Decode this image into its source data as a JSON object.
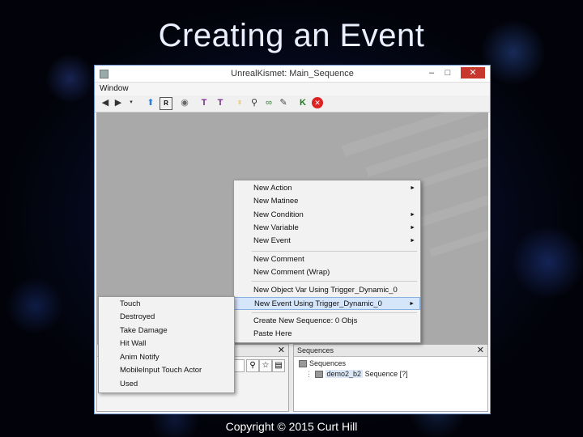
{
  "slide": {
    "title": "Creating an Event",
    "copyright": "Copyright © 2015 Curt Hill"
  },
  "window": {
    "title": "UnrealKismet: Main_Sequence",
    "minimize": "–",
    "maximize": "□",
    "close": "✕",
    "menu": [
      "Window"
    ]
  },
  "context_menu": {
    "items": [
      {
        "label": "New Action",
        "submenu": true
      },
      {
        "label": "New Matinee",
        "submenu": false
      },
      {
        "label": "New Condition",
        "submenu": true
      },
      {
        "label": "New Variable",
        "submenu": true
      },
      {
        "label": "New Event",
        "submenu": true
      },
      {
        "label": "New Comment",
        "submenu": false
      },
      {
        "label": "New Comment (Wrap)",
        "submenu": false
      },
      {
        "label": "New Object Var Using Trigger_Dynamic_0",
        "submenu": false
      },
      {
        "label": "New Event Using Trigger_Dynamic_0",
        "submenu": true,
        "highlighted": true
      },
      {
        "label": "Create New Sequence: 0 Objs",
        "submenu": false
      },
      {
        "label": "Paste Here",
        "submenu": false
      }
    ],
    "arrow": "►"
  },
  "event_submenu": {
    "items": [
      "Touch",
      "Destroyed",
      "Take Damage",
      "Hit Wall",
      "Anim Notify",
      "MobileInput Touch Actor",
      "Used"
    ]
  },
  "sequences_panel": {
    "title": "Sequences",
    "close": "✕",
    "root": "Sequences",
    "child_name": "demo2_b2",
    "child_type": "Sequence [?]"
  },
  "left_panel": {
    "close": "✕"
  },
  "icons": {
    "toolbar": [
      "back-arrow-icon",
      "forward-arrow-icon",
      "dropdown-icon",
      "up-arrow-icon",
      "open-icon",
      "eye-icon",
      "bracket-icon-1",
      "bracket-icon-2",
      "lightbulb-icon",
      "search-icon",
      "link-icon",
      "hide-icon",
      "k-arrow-icon",
      "stop-icon"
    ]
  }
}
